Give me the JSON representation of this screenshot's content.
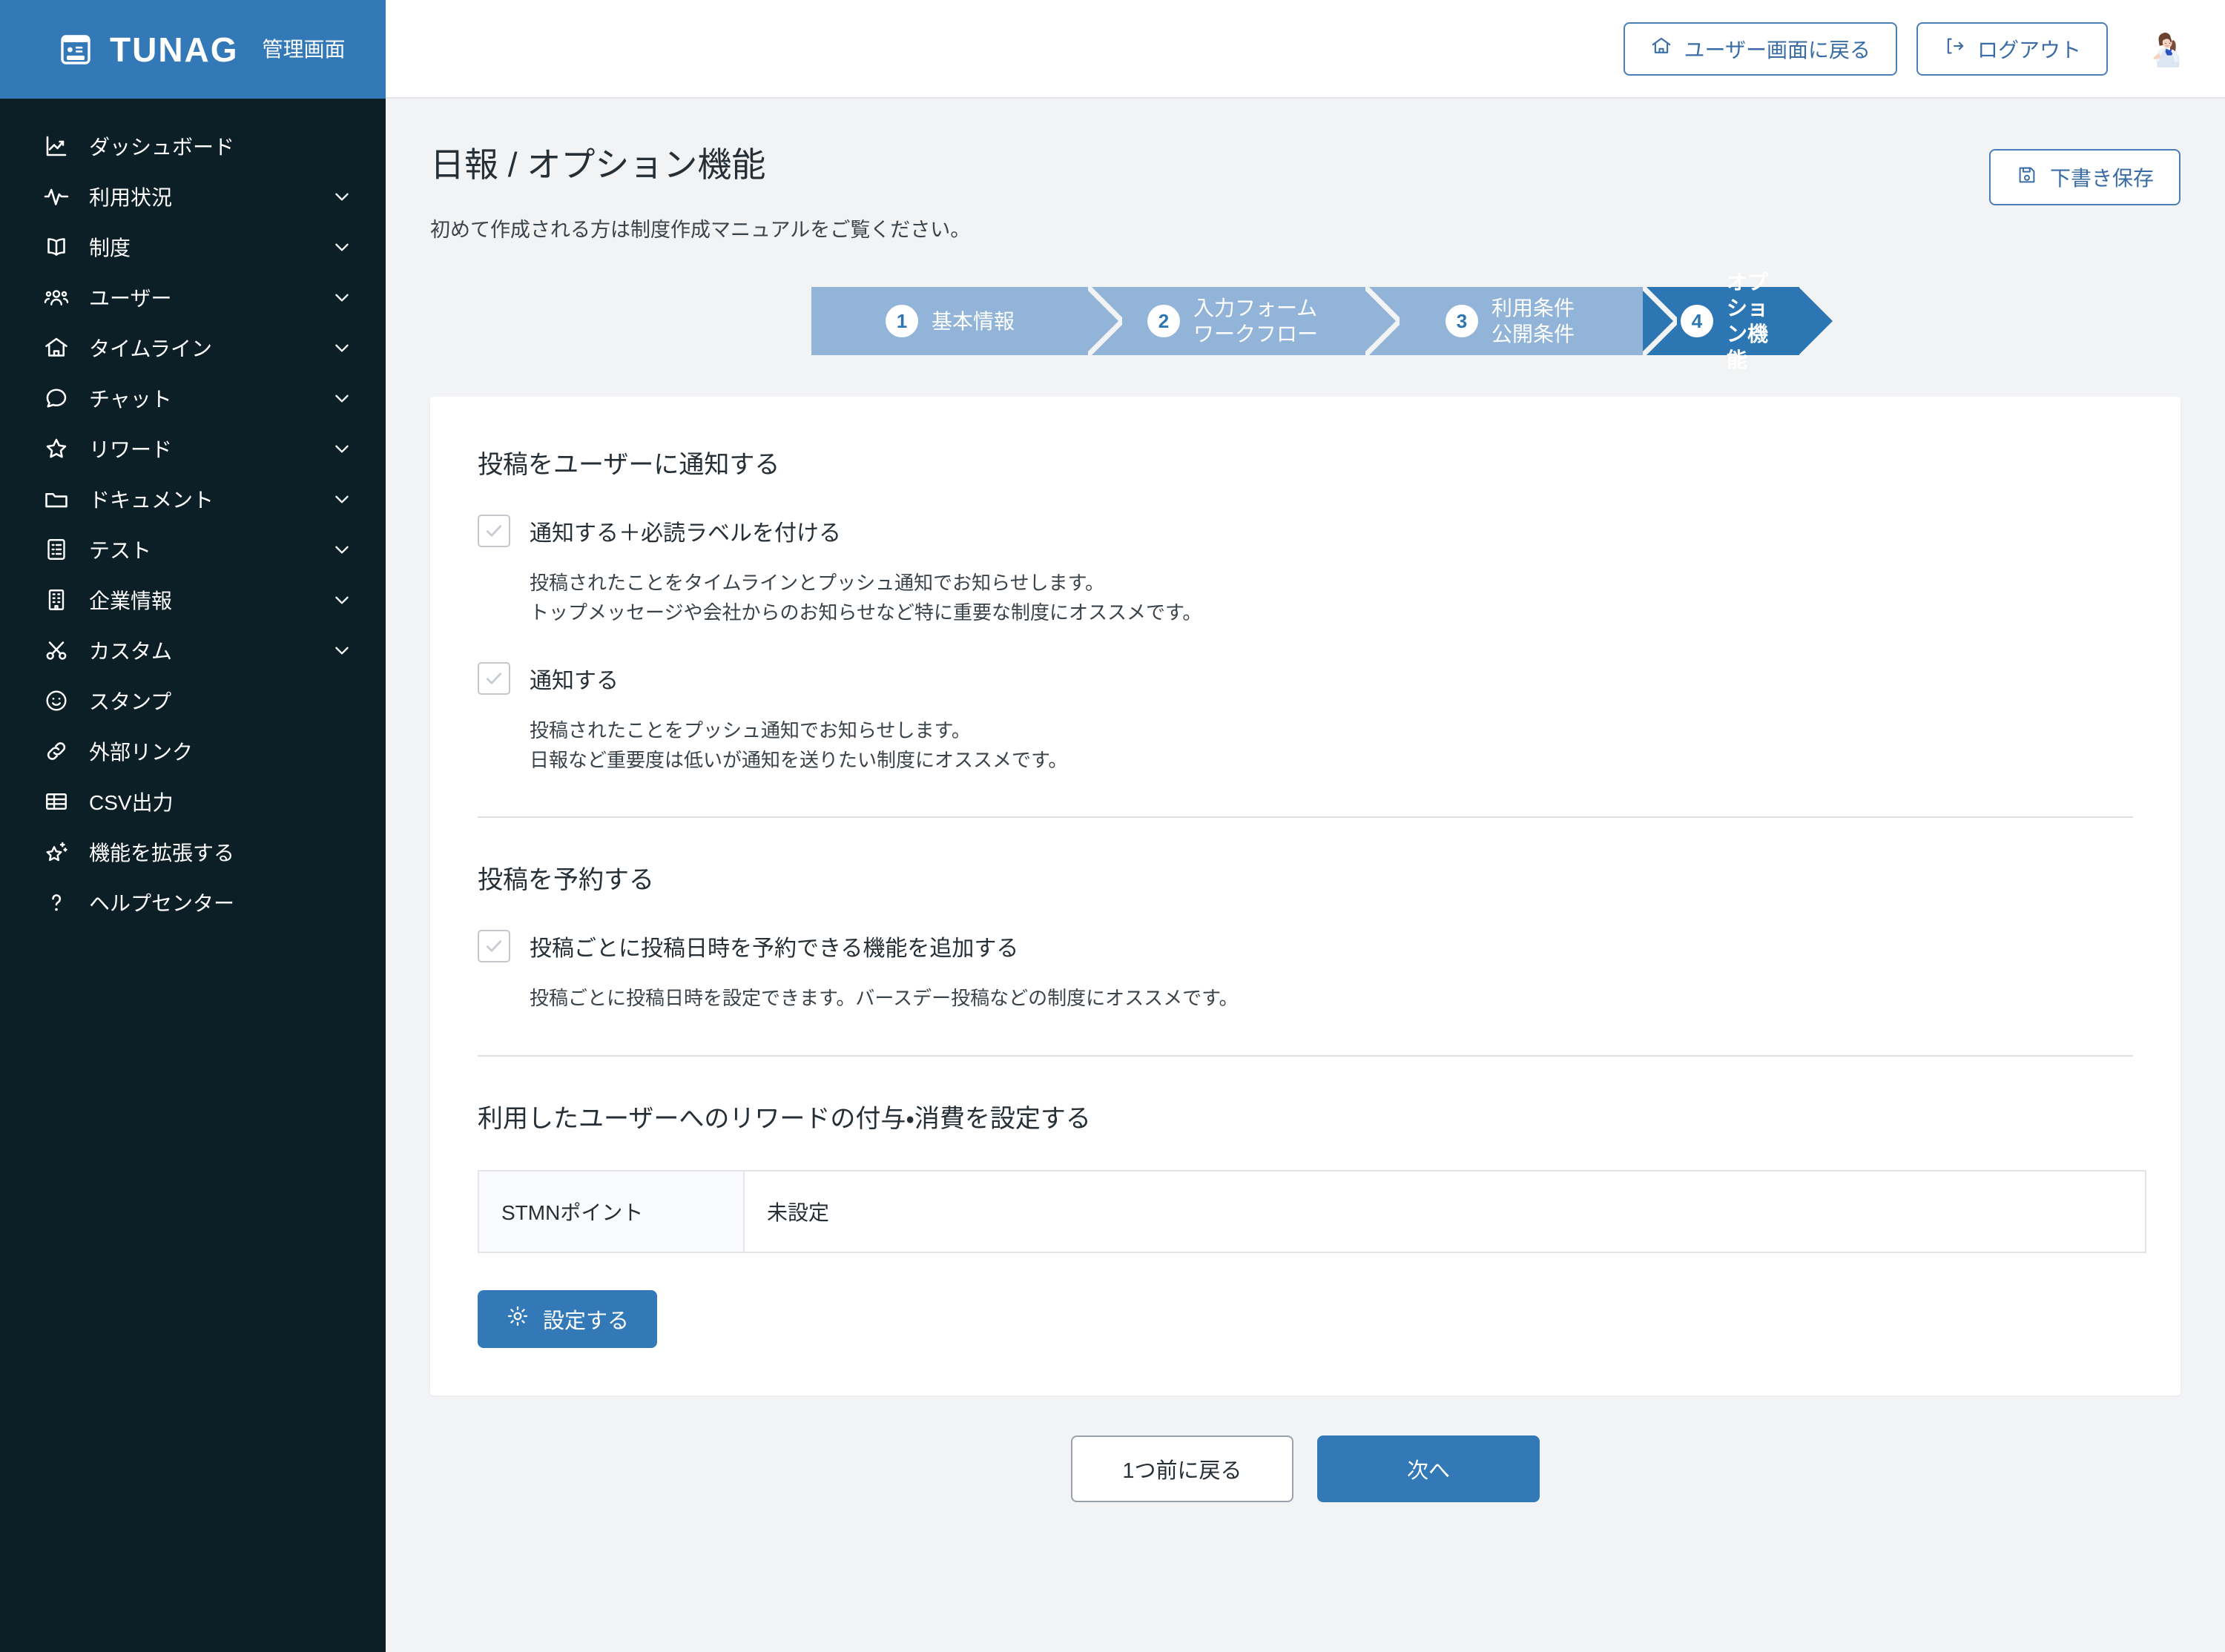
{
  "brand": {
    "name": "TUNAG",
    "subtitle": "管理画面",
    "logo_icon": "id-card-icon"
  },
  "sidebar": {
    "items": [
      {
        "label": "ダッシュボード",
        "icon": "chart-line-icon",
        "chevron": false
      },
      {
        "label": "利用状況",
        "icon": "pulse-icon",
        "chevron": true
      },
      {
        "label": "制度",
        "icon": "book-open-icon",
        "chevron": true
      },
      {
        "label": "ユーザー",
        "icon": "users-icon",
        "chevron": true
      },
      {
        "label": "タイムライン",
        "icon": "home-icon",
        "chevron": true
      },
      {
        "label": "チャット",
        "icon": "chat-bubble-icon",
        "chevron": true
      },
      {
        "label": "リワード",
        "icon": "star-icon",
        "chevron": true
      },
      {
        "label": "ドキュメント",
        "icon": "folder-icon",
        "chevron": true
      },
      {
        "label": "テスト",
        "icon": "clipboard-icon",
        "chevron": true
      },
      {
        "label": "企業情報",
        "icon": "building-icon",
        "chevron": true
      },
      {
        "label": "カスタム",
        "icon": "scissors-icon",
        "chevron": true
      },
      {
        "label": "スタンプ",
        "icon": "smiley-icon",
        "chevron": false
      },
      {
        "label": "外部リンク",
        "icon": "link-icon",
        "chevron": false
      },
      {
        "label": "CSV出力",
        "icon": "table-icon",
        "chevron": false
      },
      {
        "label": "機能を拡張する",
        "icon": "sparkle-star-icon",
        "chevron": false
      },
      {
        "label": "ヘルプセンター",
        "icon": "question-icon",
        "chevron": false
      }
    ]
  },
  "topbar": {
    "back_to_user": "ユーザー画面に戻る",
    "back_to_user_icon": "home-icon",
    "logout": "ログアウト",
    "logout_icon": "logout-icon",
    "avatar_name": "user-avatar"
  },
  "page": {
    "title": "日報 / オプション機能",
    "note": "初めて作成される方は制度作成マニュアルをご覧ください。",
    "draft_save": "下書き保存",
    "draft_save_icon": "save-icon"
  },
  "steps": [
    {
      "num": "1",
      "label": "基本情報",
      "active": false
    },
    {
      "num": "2",
      "label": "入力フォーム\nワークフロー",
      "active": false
    },
    {
      "num": "3",
      "label": "利用条件\n公開条件",
      "active": false
    },
    {
      "num": "4",
      "label": "オプション機能",
      "active": true
    }
  ],
  "notify_section": {
    "title": "投稿をユーザーに通知する",
    "options": [
      {
        "label": "通知する＋必読ラベルを付ける",
        "checked": true,
        "description": "投稿されたことをタイムラインとプッシュ通知でお知らせします。\nトップメッセージや会社からのお知らせなど特に重要な制度にオススメです。"
      },
      {
        "label": "通知する",
        "checked": true,
        "description": "投稿されたことをプッシュ通知でお知らせします。\n日報など重要度は低いが通知を送りたい制度にオススメです。"
      }
    ]
  },
  "schedule_section": {
    "title": "投稿を予約する",
    "option": {
      "label": "投稿ごとに投稿日時を予約できる機能を追加する",
      "checked": true,
      "description": "投稿ごとに投稿日時を設定できます。バースデー投稿などの制度にオススメです。"
    }
  },
  "reward_section": {
    "title": "利用したユーザーへのリワードの付与・消費を設定する",
    "rows": [
      {
        "key": "STMNポイント",
        "value": "未設定"
      }
    ],
    "settings_button": "設定する",
    "settings_icon": "gear-icon"
  },
  "footer": {
    "back": "1つ前に戻る",
    "next": "次へ"
  },
  "colors": {
    "brand_blue": "#3379b7",
    "sidebar_dark": "#0d1f26",
    "step_inactive": "#92b4d8",
    "step_active": "#2c76b4",
    "page_bg": "#f2f3f5",
    "border": "#e3e5e8"
  }
}
